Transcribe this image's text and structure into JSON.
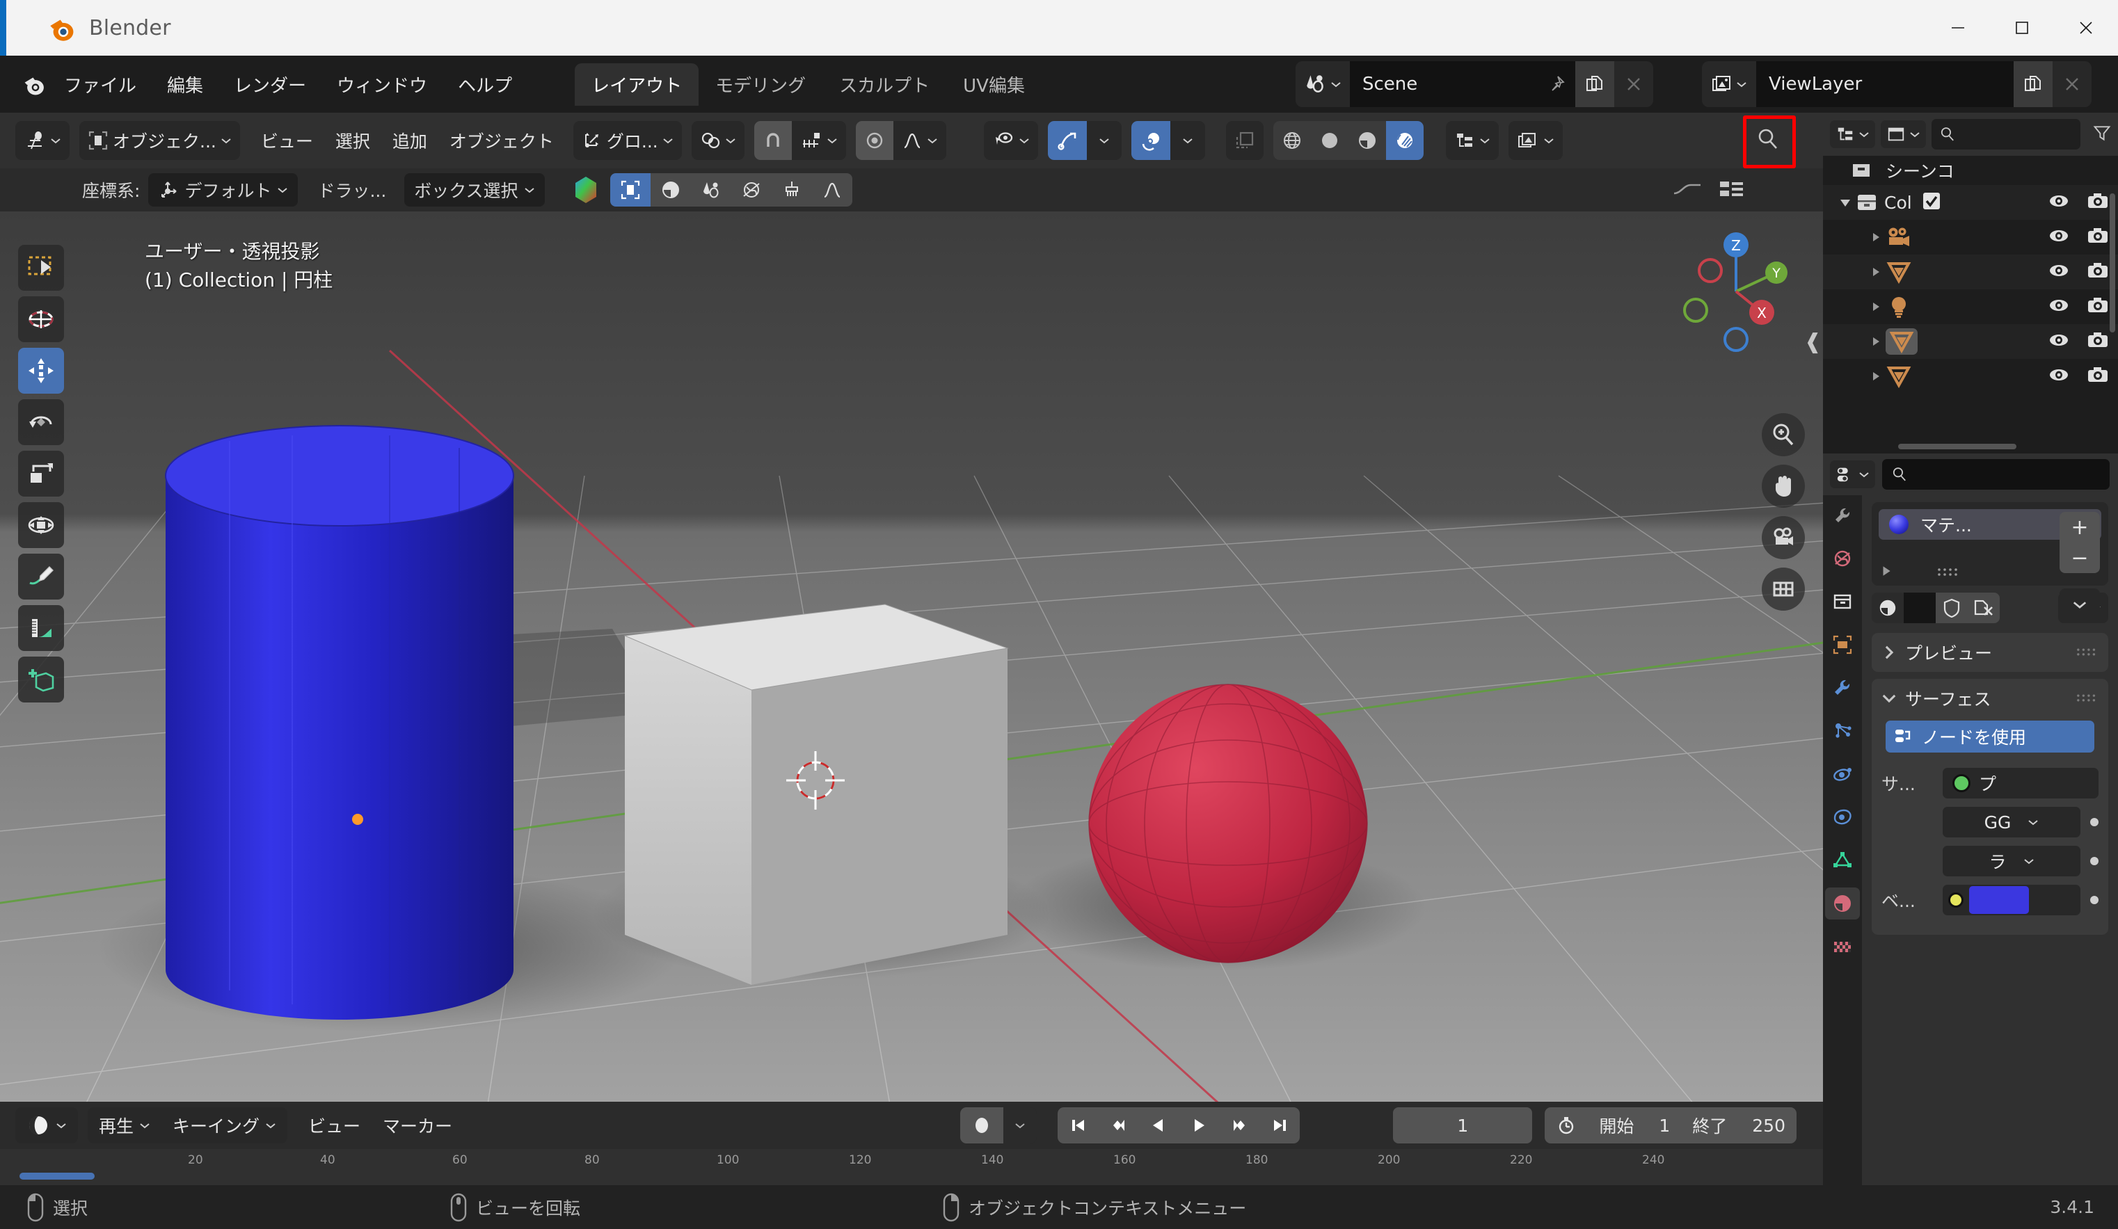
{
  "window": {
    "app_title": "Blender",
    "minimize": "minimize-button",
    "maximize": "maximize-button",
    "close": "close-button"
  },
  "topbar": {
    "menus": [
      "ファイル",
      "編集",
      "レンダー",
      "ウィンドウ",
      "ヘルプ"
    ],
    "workspace_tabs": [
      {
        "label": "レイアウト",
        "active": true
      },
      {
        "label": "モデリング",
        "active": false
      },
      {
        "label": "スカルプト",
        "active": false
      },
      {
        "label": "UV編集",
        "active": false
      }
    ],
    "scene": {
      "value": "Scene",
      "new_label": "new-scene",
      "delete_label": "delete-scene"
    },
    "view_layer": {
      "value": "ViewLayer",
      "new_label": "new-view-layer",
      "delete_label": "delete-view-layer"
    }
  },
  "viewport_header": {
    "editor_type": "editor-type-3d-viewport",
    "mode": "オブジェク...",
    "menus": [
      "ビュー",
      "選択",
      "追加",
      "オブジェクト"
    ],
    "transform_orientation": "グロ...",
    "pivot": "pivot-point",
    "snap": "snap-magnet",
    "proportional_edit": "proportional-editing",
    "visibility": "object-visibility",
    "gizmo": "show-gizmo",
    "overlays": "show-overlays",
    "xray": "toggle-xray",
    "shading": [
      {
        "name": "wireframe",
        "active": false
      },
      {
        "name": "solid",
        "active": false
      },
      {
        "name": "material-preview",
        "active": false
      },
      {
        "name": "rendered",
        "active": true,
        "highlighted": true
      }
    ],
    "highlight_color": "#ff0000"
  },
  "tool_settings": {
    "orientation_label": "座標系:",
    "orientation_value": "デフォルト",
    "drag_label": "ドラッ...",
    "drag_value": "ボックス選択",
    "toggles": [
      "color-picker-hex",
      "select-box",
      "shading-mode",
      "scene-properties",
      "world-properties",
      "brush"
    ],
    "search_placeholder": ""
  },
  "viewport": {
    "overlay_line1": "ユーザー・透視投影",
    "overlay_line2": "(1) Collection | 円柱",
    "toolbar": [
      {
        "name": "tweak-tool",
        "active": false
      },
      {
        "name": "cursor-tool",
        "active": false
      },
      {
        "name": "move-tool",
        "active": true
      },
      {
        "name": "rotate-tool",
        "active": false
      },
      {
        "name": "scale-tool",
        "active": false
      },
      {
        "name": "transform-tool",
        "active": false
      },
      {
        "name": "annotate-tool",
        "active": false
      },
      {
        "name": "measure-tool",
        "active": false
      },
      {
        "name": "add-cube-tool",
        "active": false
      }
    ],
    "gizmo_buttons": [
      "zoom-view",
      "move-view",
      "camera-view",
      "toggle-orthographic"
    ],
    "axis_labels": [
      "X",
      "Y",
      "Z"
    ],
    "objects": [
      {
        "name": "円柱",
        "color": "#2b2bc8",
        "type": "cylinder"
      },
      {
        "name": "立方体",
        "color": "#c9c9c9",
        "type": "cube"
      },
      {
        "name": "球",
        "color": "#b8253f",
        "type": "sphere"
      }
    ]
  },
  "timeline": {
    "editor_type": "editor-type-timeline",
    "playback": "再生",
    "keying": "キーイング",
    "menus": [
      "ビュー",
      "マーカー"
    ],
    "auto_keying": "auto-keying-toggle",
    "transport": [
      "jump-to-start",
      "jump-to-prev-keyframe",
      "play-reverse",
      "play",
      "jump-to-next-keyframe",
      "jump-to-end"
    ],
    "current_frame": "1",
    "start_label": "開始",
    "start_value": "1",
    "end_label": "終了",
    "end_value": "250",
    "ticks": [
      "20",
      "40",
      "60",
      "80",
      "100",
      "120",
      "140",
      "160",
      "180",
      "200",
      "220",
      "240"
    ]
  },
  "outliner": {
    "editor_type": "editor-type-outliner",
    "display_mode": "view-layer",
    "search_placeholder": "",
    "scene_label": "シーンコ",
    "filter": "filter-icon",
    "collection": {
      "label": "Col",
      "checked": true,
      "expanded": true
    },
    "items": [
      {
        "icon": "camera-icon",
        "name": "",
        "selected": false
      },
      {
        "icon": "mesh-data-icon",
        "name": "",
        "selected": false
      },
      {
        "icon": "light-icon",
        "name": "",
        "selected": false
      },
      {
        "icon": "mesh-data-icon",
        "name": "",
        "selected": true
      },
      {
        "icon": "mesh-data-icon",
        "name": "",
        "selected": false
      }
    ]
  },
  "properties": {
    "editor_type": "editor-type-properties",
    "search_placeholder": "",
    "tabs": [
      {
        "name": "tool-tab",
        "active": false
      },
      {
        "name": "render-tab",
        "active": false
      },
      {
        "name": "output-tab",
        "active": false
      },
      {
        "name": "view-layer-tab",
        "active": false
      },
      {
        "name": "scene-tab",
        "active": false
      },
      {
        "name": "world-tab",
        "active": false
      },
      {
        "name": "collection-tab",
        "active": false
      },
      {
        "name": "object-tab",
        "active": false
      },
      {
        "name": "modifier-tab",
        "active": false
      },
      {
        "name": "particles-tab",
        "active": false
      },
      {
        "name": "physics-tab",
        "active": false
      },
      {
        "name": "constraints-tab",
        "active": false
      },
      {
        "name": "object-data-tab",
        "active": false
      },
      {
        "name": "material-tab",
        "active": true
      },
      {
        "name": "texture-tab",
        "active": false
      }
    ],
    "material_slot": "マテ...",
    "add_slot": "+",
    "remove_slot": "−",
    "slot_specials": "slot-specials-dropdown",
    "browse_material": "browse-material",
    "fake_user": "fake-user-shield",
    "unlink": "unlink-material",
    "data_dropdown": "material-data-dropdown",
    "preview_panel": "プレビュー",
    "surface_panel": "サーフェス",
    "use_nodes": "ノードを使用",
    "surface_label": "サ...",
    "surface_value": "プ",
    "distribution_value": "GG",
    "mode_value": "ラ",
    "base_color_label": "ベ...",
    "base_color_hex": "#3b37e0"
  },
  "statusbar": {
    "select_text": "選択",
    "rotate_text": "ビューを回転",
    "context_menu_text": "オブジェクトコンテキストメニュー",
    "version": "3.4.1"
  }
}
